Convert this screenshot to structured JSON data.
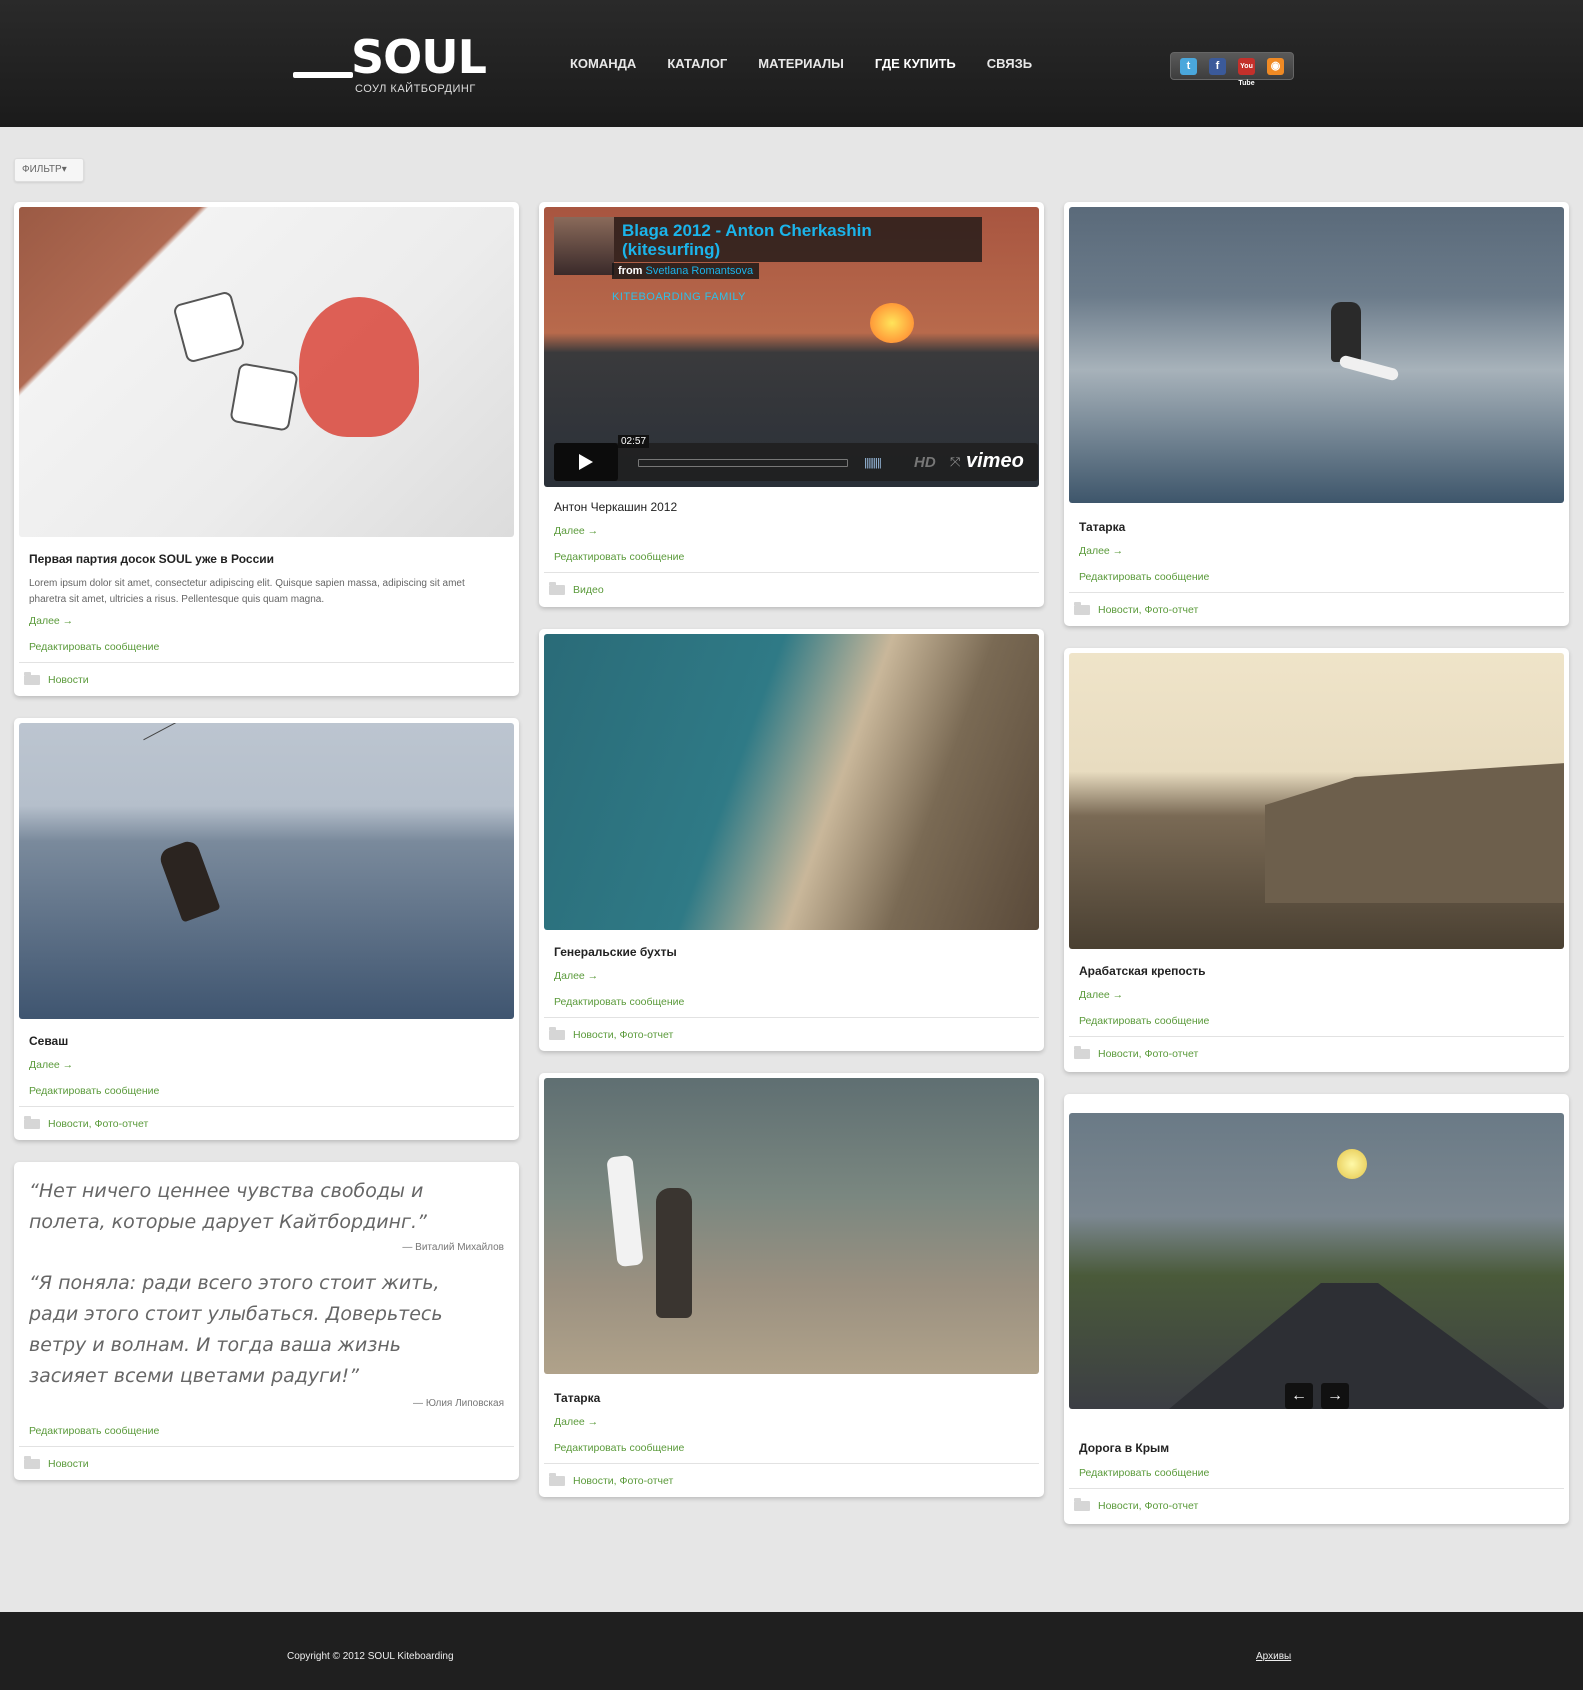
{
  "header": {
    "logo_word": "SOUL",
    "logo_sub": "СОУЛ КАЙТБОРДИНГ",
    "nav": [
      "КОМАНДА",
      "КАТАЛОГ",
      "МАТЕРИАЛЫ",
      "ГДЕ КУПИТЬ",
      "СВЯЗЬ"
    ],
    "social_icons": [
      "twitter-icon",
      "facebook-icon",
      "youtube-icon",
      "rss-icon"
    ],
    "social_glyphs": [
      "t",
      "f",
      "You Tube",
      "◉"
    ]
  },
  "filter": {
    "label": "ФИЛЬТР"
  },
  "common": {
    "more": "Далее →",
    "edit": "Редактировать сообщение"
  },
  "posts": {
    "board": {
      "title": "Первая партия досок SOUL уже в России",
      "excerpt": "Lorem ipsum dolor sit amet, consectetur adipiscing elit. Quisque sapien massa, adipiscing sit amet pharetra sit amet, ultricies a risus. Pellentesque quis quam magna.",
      "cats": "Новости"
    },
    "sevash": {
      "title": "Севаш",
      "cats": "Новости, Фото-отчет"
    },
    "quotes": {
      "q1": "“Нет ничего ценнее чувства свободы и полета, которые дарует Кайтбординг.”",
      "a1": "— Виталий Михайлов",
      "q2": "“Я поняла: ради всего этого стоит жить, ради этого стоит улыбаться. Доверьтесь ветру и волнам. И тогда ваша жизнь засияет всеми цветами радуги!”",
      "a2": "— Юлия Липовская",
      "cats": "Новости"
    },
    "video": {
      "video_title": "Blaga 2012 - Anton Cherkashin (kitesurfing)",
      "from": "from",
      "author": "Svetlana Romantsova",
      "overlay_brand": "KITEBOARDING FAMILY",
      "time": "02:57",
      "hd": "HD",
      "player_logo": "vimeo",
      "title": "Антон Черкашин 2012",
      "cats": "Видео"
    },
    "bays": {
      "title": "Генеральские бухты",
      "cats": "Новости, Фото-отчет"
    },
    "tatarka2": {
      "title": "Татарка",
      "cats": "Новости, Фото-отчет"
    },
    "tatarka1": {
      "title": "Татарка",
      "cats": "Новости, Фото-отчет"
    },
    "fort": {
      "title": "Арабатская крепость",
      "cats": "Новости, Фото-отчет"
    },
    "road": {
      "title": "Дорога в Крым",
      "cats": "Новости, Фото-отчет"
    }
  },
  "slider": {
    "prev": "←",
    "next": "→"
  },
  "footer": {
    "copyright": "Copyright © 2012 SOUL Kiteboarding",
    "archive": "Архивы"
  }
}
